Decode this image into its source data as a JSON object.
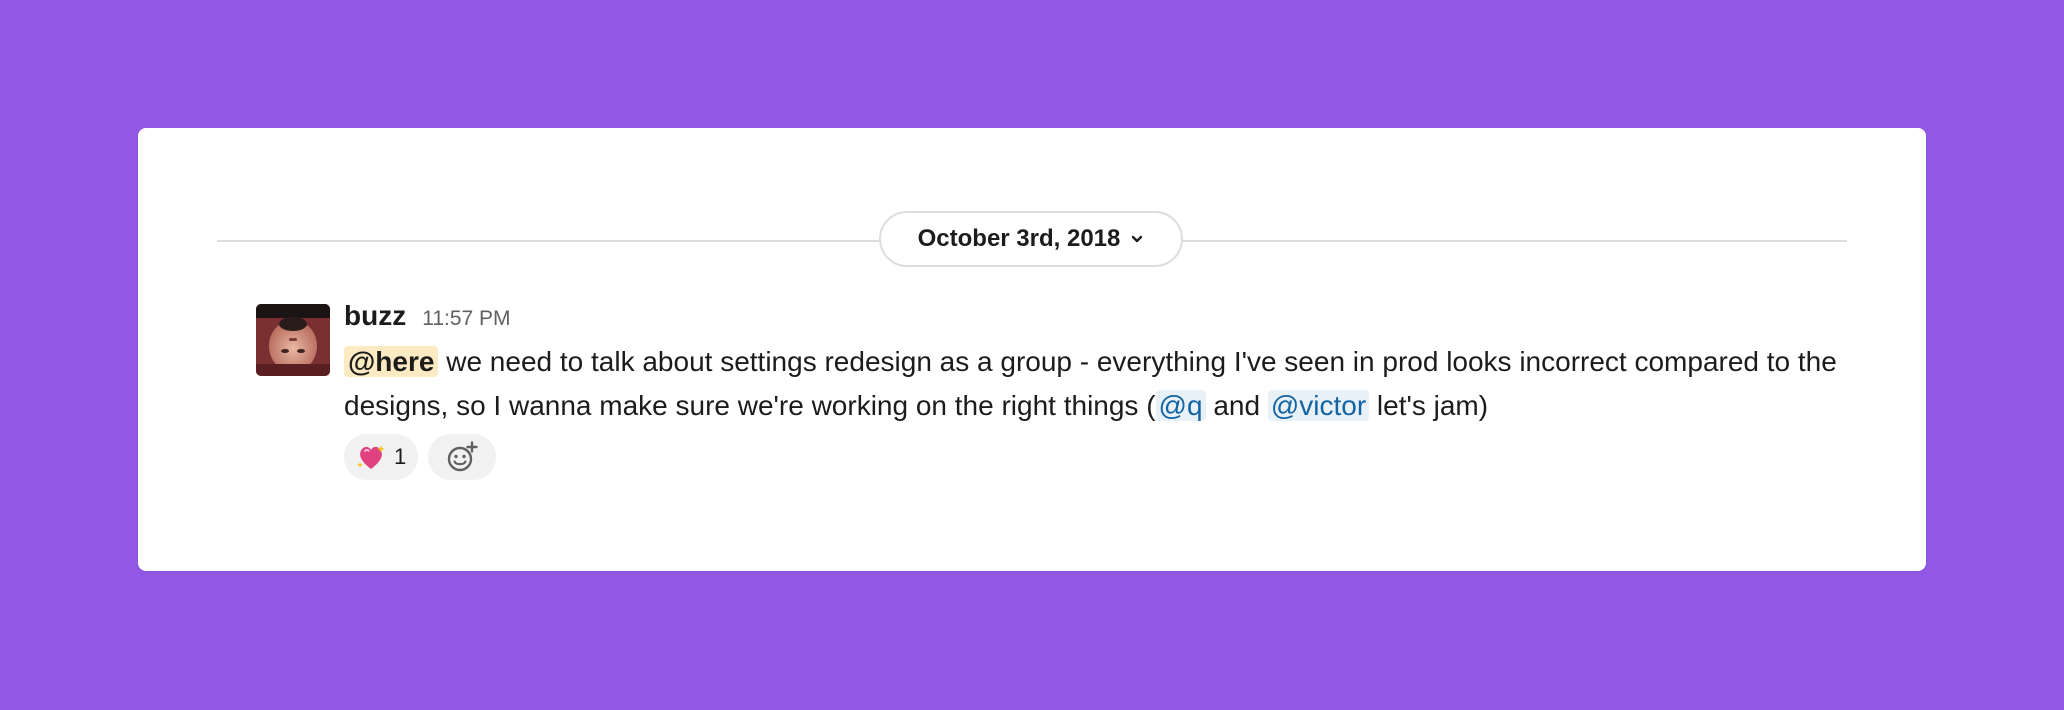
{
  "date_divider": {
    "label": "October 3rd, 2018",
    "icon": "chevron-down-icon"
  },
  "message": {
    "author": "buzz",
    "time": "11:57 PM",
    "avatar_icon": "user-avatar",
    "here_mention": "@here",
    "text_part1": " we need to talk about settings redesign as a group - everything I've seen in prod looks incorrect compared to the designs, so I wanna make sure we're working on the right things (",
    "mention_q": "@q",
    "text_part2": " and ",
    "mention_victor": "@victor",
    "text_part3": " let's jam)"
  },
  "reactions": [
    {
      "emoji": "sparkling-heart-icon",
      "count": "1"
    }
  ],
  "add_reaction": {
    "icon": "add-reaction-icon"
  },
  "colors": {
    "background": "#9259e6",
    "card": "#ffffff",
    "here_highlight": "#fbeac2",
    "mention_bg": "#e8f1f8",
    "mention_text": "#1264a3"
  }
}
